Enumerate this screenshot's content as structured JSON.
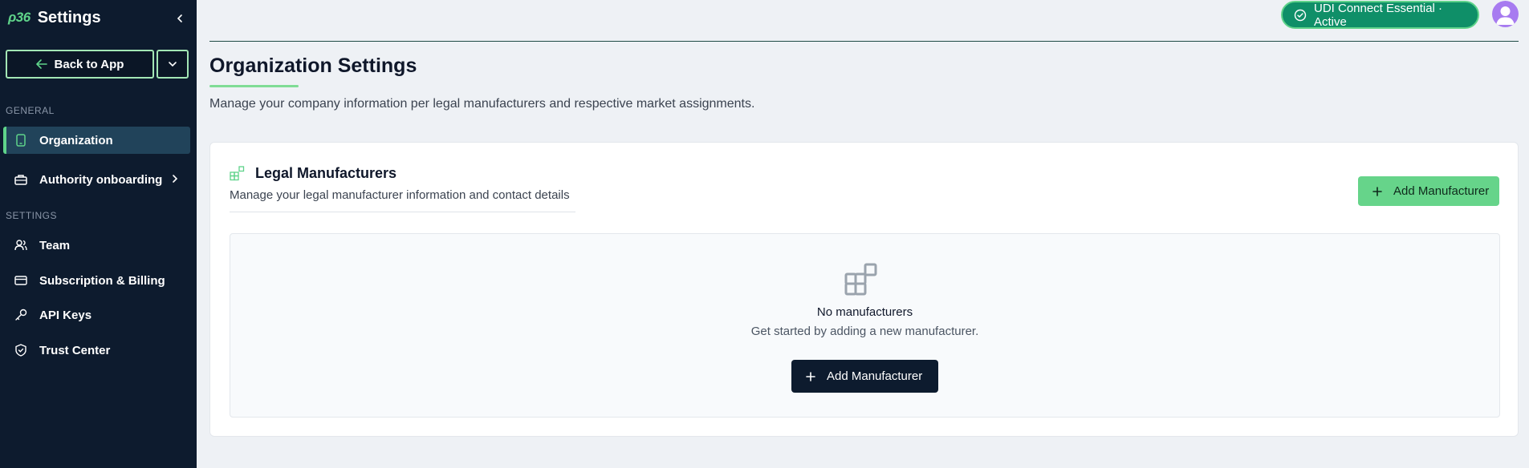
{
  "sidebar": {
    "logo": "ρ36",
    "title": "Settings",
    "back_label": "Back to App",
    "general_label": "GENERAL",
    "settings_label": "SETTINGS",
    "items": [
      {
        "label": "Organization",
        "icon": "tablet-icon",
        "active": true
      },
      {
        "label": "Authority onboarding",
        "icon": "briefcase-icon",
        "has_submenu": true
      },
      {
        "label": "Team",
        "icon": "users-icon"
      },
      {
        "label": "Subscription & Billing",
        "icon": "credit-card-icon"
      },
      {
        "label": "API Keys",
        "icon": "key-icon"
      },
      {
        "label": "Trust Center",
        "icon": "shield-check-icon"
      }
    ]
  },
  "topbar": {
    "status_label": "UDI Connect Essential · Active"
  },
  "header": {
    "title": "Organization Settings",
    "subtitle": "Manage your company information per legal manufacturers and respective market assignments."
  },
  "manufacturers": {
    "title": "Legal Manufacturers",
    "subtitle": "Manage your legal manufacturer information and contact details",
    "add_label": "Add Manufacturer",
    "empty_title": "No manufacturers",
    "empty_subtitle": "Get started by adding a new manufacturer.",
    "empty_add_label": "Add Manufacturer"
  },
  "colors": {
    "sidebar_bg": "#0d1b2e",
    "accent_green": "#5fd38a",
    "status_bg": "#0f8f68",
    "avatar": "#a77bf0"
  }
}
